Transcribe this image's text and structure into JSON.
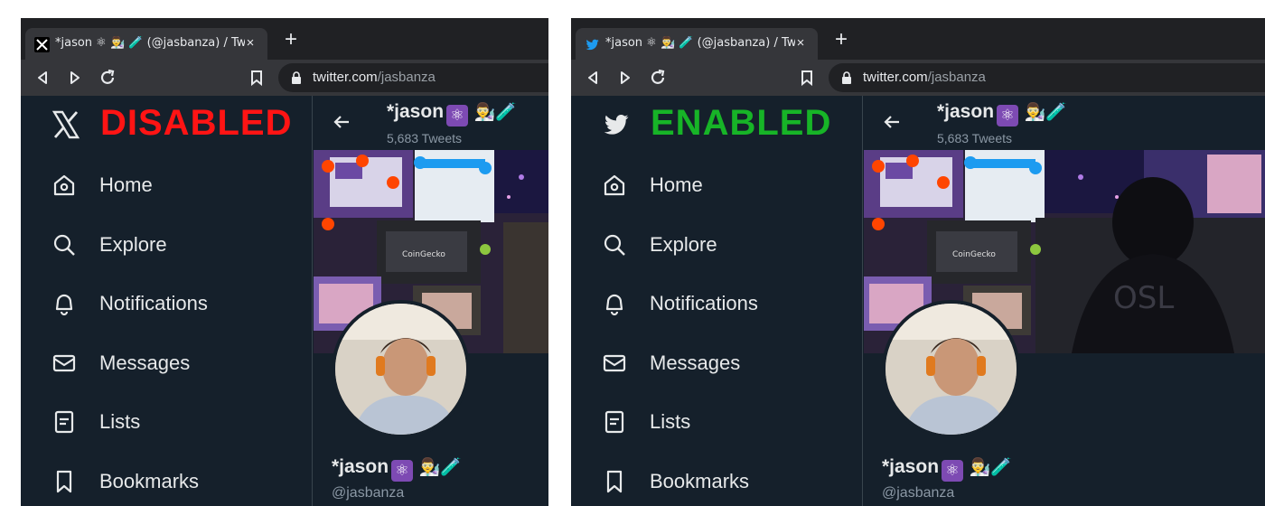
{
  "panels": [
    {
      "status": "DISABLED",
      "status_color": "#ff1414",
      "brand_icon": "x-logo-icon",
      "tab": {
        "title": "*jason ⚛ 👨‍🔬 🧪 (@jasbanza) / Tw",
        "favicon": "x-favicon-icon",
        "close": "×"
      },
      "newtab": "+",
      "url": {
        "host": "twitter.com",
        "path": "/jasbanza"
      },
      "nav": [
        {
          "label": "Home",
          "icon": "home-icon"
        },
        {
          "label": "Explore",
          "icon": "search-icon"
        },
        {
          "label": "Notifications",
          "icon": "bell-icon"
        },
        {
          "label": "Messages",
          "icon": "envelope-icon"
        },
        {
          "label": "Lists",
          "icon": "list-icon"
        },
        {
          "label": "Bookmarks",
          "icon": "bookmark-icon"
        }
      ],
      "profile": {
        "name": "*jason",
        "name_emoji": "👨‍🔬🧪",
        "tweet_count": "5,683 Tweets",
        "handle": "@jasbanza"
      }
    },
    {
      "status": "ENABLED",
      "status_color": "#17b427",
      "brand_icon": "twitter-bird-icon",
      "tab": {
        "title": "*jason ⚛ 👨‍🔬 🧪 (@jasbanza) / Tw",
        "favicon": "twitter-bird-favicon-icon",
        "close": "×"
      },
      "newtab": "+",
      "url": {
        "host": "twitter.com",
        "path": "/jasbanza"
      },
      "nav": [
        {
          "label": "Home",
          "icon": "home-icon"
        },
        {
          "label": "Explore",
          "icon": "search-icon"
        },
        {
          "label": "Notifications",
          "icon": "bell-icon"
        },
        {
          "label": "Messages",
          "icon": "envelope-icon"
        },
        {
          "label": "Lists",
          "icon": "list-icon"
        },
        {
          "label": "Bookmarks",
          "icon": "bookmark-icon"
        }
      ],
      "profile": {
        "name": "*jason",
        "name_emoji": "👨‍🔬🧪",
        "tweet_count": "5,683 Tweets",
        "handle": "@jasbanza"
      }
    }
  ],
  "banner_texts": [
    "CoinGecko",
    "OSL"
  ],
  "colors": {
    "background": "#15202b",
    "text": "#e7e9ea",
    "muted": "#8b98a5",
    "divider": "#38444d",
    "twitter_blue": "#1d9bf0"
  }
}
